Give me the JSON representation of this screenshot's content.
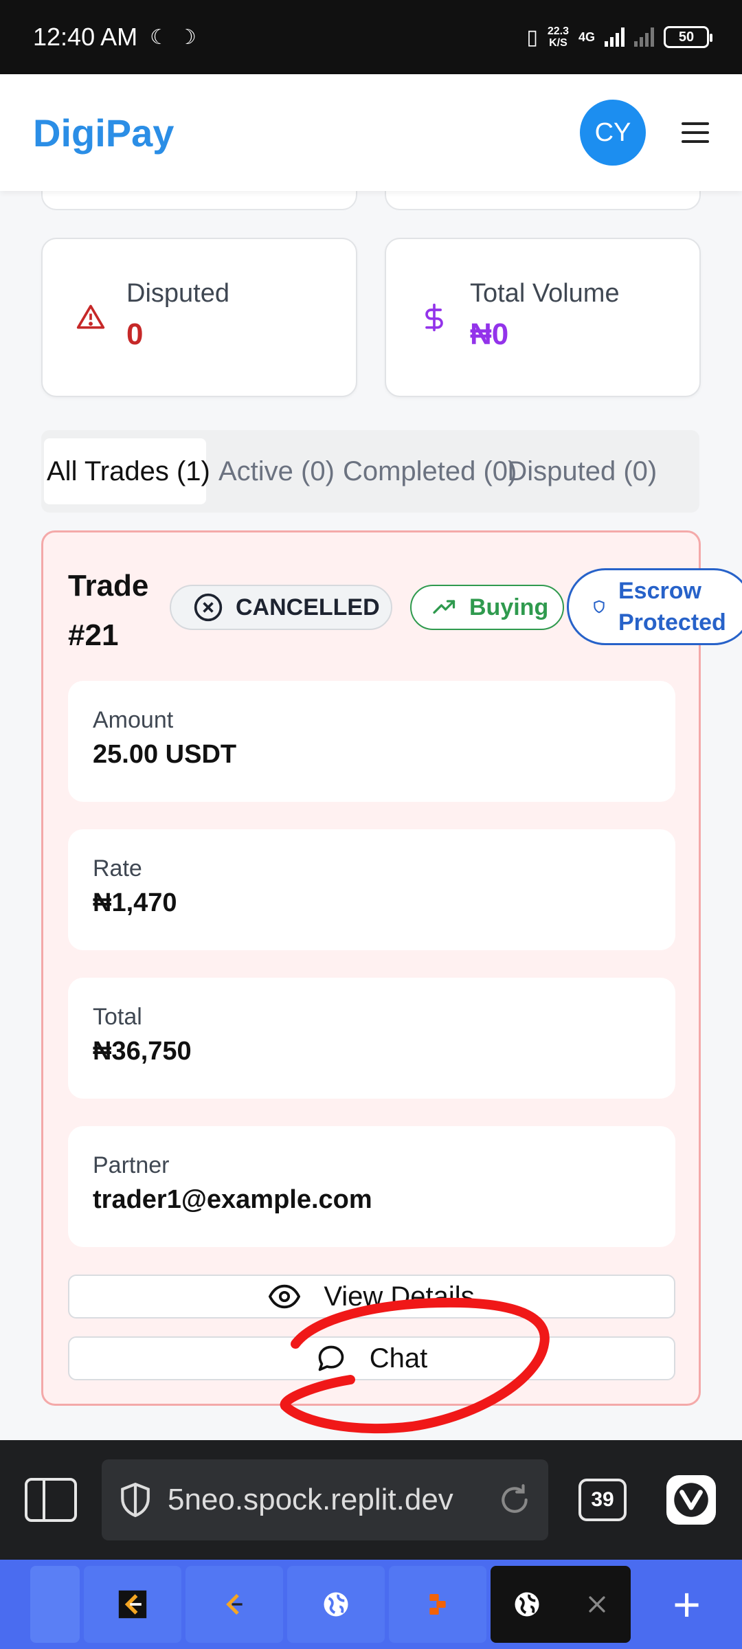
{
  "status_bar": {
    "time": "12:40 AM",
    "net_speed_top": "22.3",
    "net_speed_bottom": "K/S",
    "network": "4G",
    "battery": "50"
  },
  "header": {
    "brand": "DigiPay",
    "avatar_initials": "CY"
  },
  "stats": {
    "disputed": {
      "label": "Disputed",
      "value": "0",
      "color": "#c62828"
    },
    "total_volume": {
      "label": "Total Volume",
      "value": "₦0",
      "color": "#9333ea"
    }
  },
  "tabs": [
    {
      "label": "All Trades (1)",
      "active": true
    },
    {
      "label": "Active (0)",
      "active": false
    },
    {
      "label": "Completed (0)",
      "active": false
    },
    {
      "label": "Disputed (0)",
      "active": false
    }
  ],
  "trade": {
    "title_line1": "Trade",
    "title_line2": "#21",
    "status_badge": "CANCELLED",
    "side_badge": "Buying",
    "escrow_line1": "Escrow",
    "escrow_line2": "Protected",
    "amount": {
      "label": "Amount",
      "value": "25.00 USDT"
    },
    "rate": {
      "label": "Rate",
      "value": "₦1,470"
    },
    "total": {
      "label": "Total",
      "value": "₦36,750"
    },
    "partner": {
      "label": "Partner",
      "value": "trader1@example.com"
    },
    "view_details_label": "View Details",
    "chat_label": "Chat"
  },
  "browser": {
    "url": "5neo.spock.replit.dev",
    "tab_count": "39"
  },
  "colors": {
    "brand_blue": "#2b8ee6",
    "annotation_red": "#f01818"
  }
}
